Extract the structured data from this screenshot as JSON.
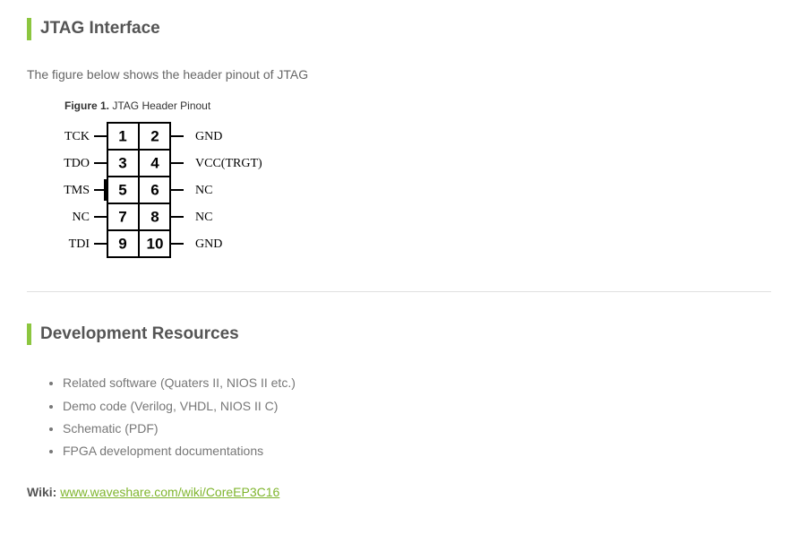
{
  "section1": {
    "heading": "JTAG Interface",
    "intro": "The figure below shows the header pinout of JTAG",
    "figure_label": "Figure 1.",
    "figure_title": "JTAG Header Pinout"
  },
  "pinout": {
    "rows": [
      {
        "left_label": "TCK",
        "left_pin": "1",
        "right_pin": "2",
        "right_label": "GND"
      },
      {
        "left_label": "TDO",
        "left_pin": "3",
        "right_pin": "4",
        "right_label": "VCC(TRGT)"
      },
      {
        "left_label": "TMS",
        "left_pin": "5",
        "right_pin": "6",
        "right_label": "NC"
      },
      {
        "left_label": "NC",
        "left_pin": "7",
        "right_pin": "8",
        "right_label": "NC"
      },
      {
        "left_label": "TDI",
        "left_pin": "9",
        "right_pin": "10",
        "right_label": "GND"
      }
    ]
  },
  "section2": {
    "heading": "Development Resources",
    "items": [
      "Related software (Quaters II, NIOS II etc.)",
      "Demo code (Verilog, VHDL, NIOS II C)",
      "Schematic (PDF)",
      "FPGA development documentations"
    ],
    "wiki_label": "Wiki:",
    "wiki_url_text": "www.waveshare.com/wiki/CoreEP3C16"
  }
}
